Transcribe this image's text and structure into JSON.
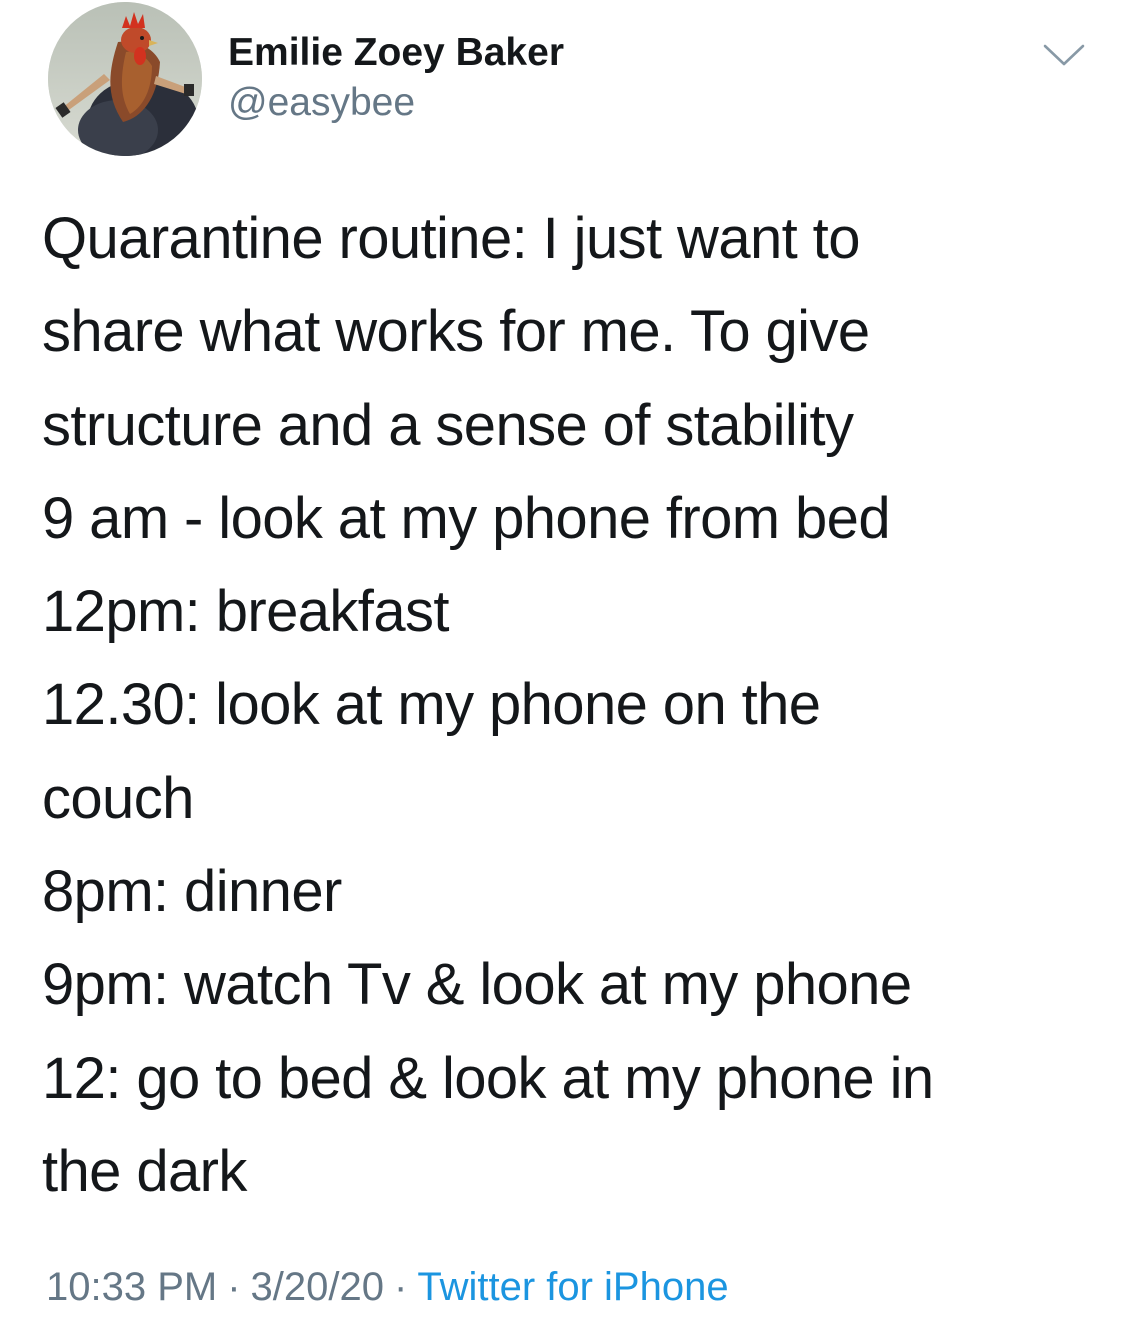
{
  "author": {
    "display_name": "Emilie Zoey Baker",
    "handle": "@easybee",
    "avatar_icon": "rooster-avatar-icon"
  },
  "menu": {
    "icon": "chevron-down-icon"
  },
  "tweet": {
    "lines": [
      "Quarantine routine: I just want to",
      "share what works for me. To give",
      "structure and a sense of stability",
      "9 am - look at my phone from bed",
      "12pm: breakfast",
      "12.30: look at my phone on the",
      "couch",
      "8pm: dinner",
      "9pm: watch Tv & look at my phone",
      "12: go to bed & look at my phone in",
      "the dark"
    ]
  },
  "meta": {
    "time": "10:33 PM",
    "separator": "·",
    "date": "3/20/20",
    "source": "Twitter for iPhone"
  },
  "colors": {
    "text": "#14171a",
    "secondary": "#657786",
    "link": "#1b95e0"
  }
}
